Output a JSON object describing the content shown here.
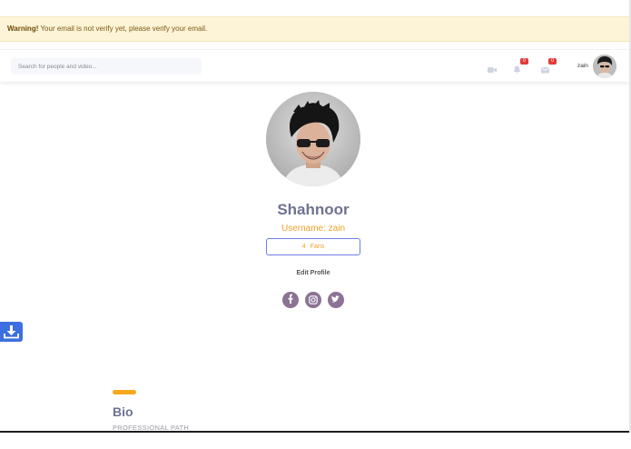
{
  "warning": {
    "label": "Warning!",
    "message": " Your email is not verify yet, please verify your email."
  },
  "navbar": {
    "search_placeholder": "Search for people and video...",
    "icons": [
      {
        "name": "video-icon",
        "badge": null
      },
      {
        "name": "notification-bell-icon",
        "badge": "0"
      },
      {
        "name": "message-icon",
        "badge": "0"
      }
    ],
    "username": "zain"
  },
  "profile": {
    "name": "Shahnoor",
    "username_label": "Username: zain",
    "fans_count": "4",
    "fans_label": "Fans",
    "edit_profile_label": "Edit Profile",
    "social_icons": [
      "facebook-icon",
      "instagram-icon",
      "twitter-icon"
    ]
  },
  "bio": {
    "title": "Bio",
    "subtitle": "PROFESSIONAL PATH"
  },
  "colors": {
    "accent_orange": "#f0a22b",
    "title_gray": "#6f7290",
    "social_purple": "#8c7394",
    "download_blue": "#3d6fe0",
    "fans_border": "#6d7ee6",
    "warning_bg": "#fdf3d6"
  }
}
